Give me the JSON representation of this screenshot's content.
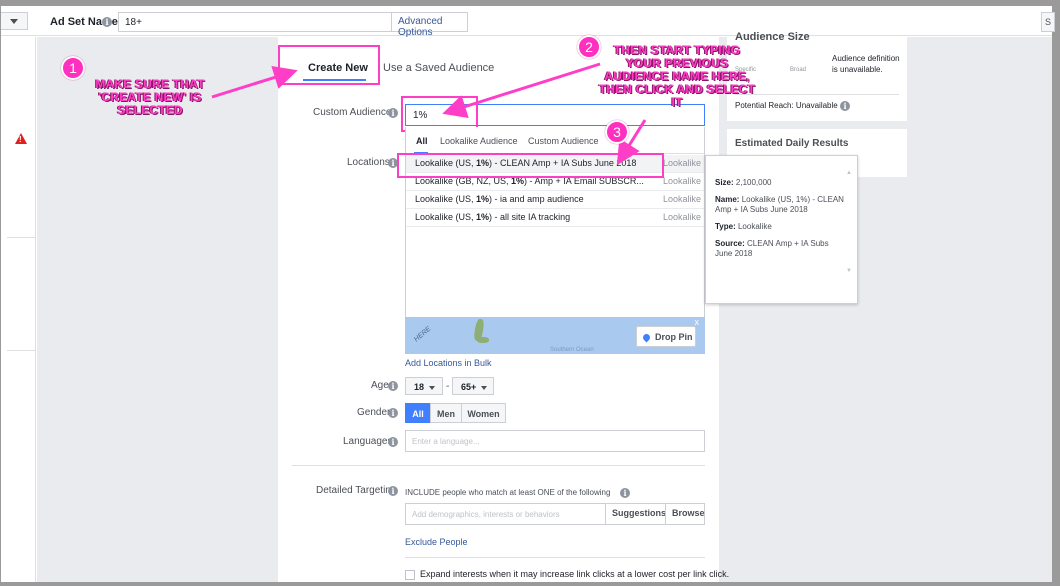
{
  "header": {
    "adset_name_label": "Ad Set Name",
    "adset_name_value": "18+",
    "advanced_options": "Advanced Options",
    "right_button": "S"
  },
  "audience_tabs": {
    "create_new": "Create New",
    "saved": "Use a Saved Audience"
  },
  "labels": {
    "custom_audiences": "Custom Audiences",
    "locations": "Locations",
    "age": "Age",
    "gender": "Gender",
    "languages": "Languages",
    "detailed_targeting": "Detailed Targeting"
  },
  "custom_audience_input": "1%",
  "dropdown": {
    "tabs": [
      "All",
      "Lookalike Audience",
      "Custom Audience"
    ],
    "rows": [
      {
        "pre": "Lookalike (US, ",
        "bold": "1%",
        "post": ") - CLEAN Amp + IA Subs June 2018",
        "type": "Lookalike"
      },
      {
        "pre": "Lookalike (GB, NZ, US, ",
        "bold": "1%",
        "post": ") - Amp + IA Email SUBSCR...",
        "type": "Lookalike"
      },
      {
        "pre": "Lookalike (US, ",
        "bold": "1%",
        "post": ") - ia and amp audience",
        "type": "Lookalike"
      },
      {
        "pre": "Lookalike (US, ",
        "bold": "1%",
        "post": ") - all site IA tracking",
        "type": "Lookalike"
      }
    ]
  },
  "map": {
    "here_label": "HERE",
    "ocean_label": "Southern Ocean",
    "close": "x",
    "drop_pin": "Drop Pin"
  },
  "add_locations_bulk": "Add Locations in Bulk",
  "age": {
    "min": "18",
    "dash": "-",
    "max": "65+"
  },
  "gender": [
    "All",
    "Men",
    "Women"
  ],
  "languages_placeholder": "Enter a language...",
  "detailed": {
    "description": "INCLUDE people who match at least ONE of the following",
    "placeholder": "Add demographics, interests or behaviors",
    "suggestions": "Suggestions",
    "browse": "Browse",
    "exclude": "Exclude People",
    "expand": "Expand interests when it may increase link clicks at a lower cost per link click."
  },
  "audience_size": {
    "title": "Audience Size",
    "specific": "Specific",
    "broad": "Broad",
    "definition": "Audience definition is unavailable.",
    "reach": "Potential Reach: Unavailable"
  },
  "estimated": {
    "title": "Estimated Daily Results"
  },
  "tooltip": {
    "size_label": "Size:",
    "size_value": "2,100,000",
    "name_label": "Name:",
    "name_value": "Lookalike (US, 1%) - CLEAN Amp + IA Subs June 2018",
    "type_label": "Type:",
    "type_value": "Lookalike",
    "source_label": "Source:",
    "source_value": "CLEAN Amp + IA Subs June 2018"
  },
  "annotations": {
    "one": {
      "num": "1",
      "text": "MAKE SURE THAT 'CREATE NEW' IS SELECTED"
    },
    "two": {
      "num": "2",
      "text": "THEN START TYPING YOUR PREVIOUS AUDIENCE NAME HERE, THEN CLICK AND SELECT IT"
    },
    "three": {
      "num": "3"
    }
  },
  "colors": {
    "accent": "#4080ff",
    "annotation": "#ff3ec8",
    "link": "#365899",
    "warning": "#e02020"
  }
}
